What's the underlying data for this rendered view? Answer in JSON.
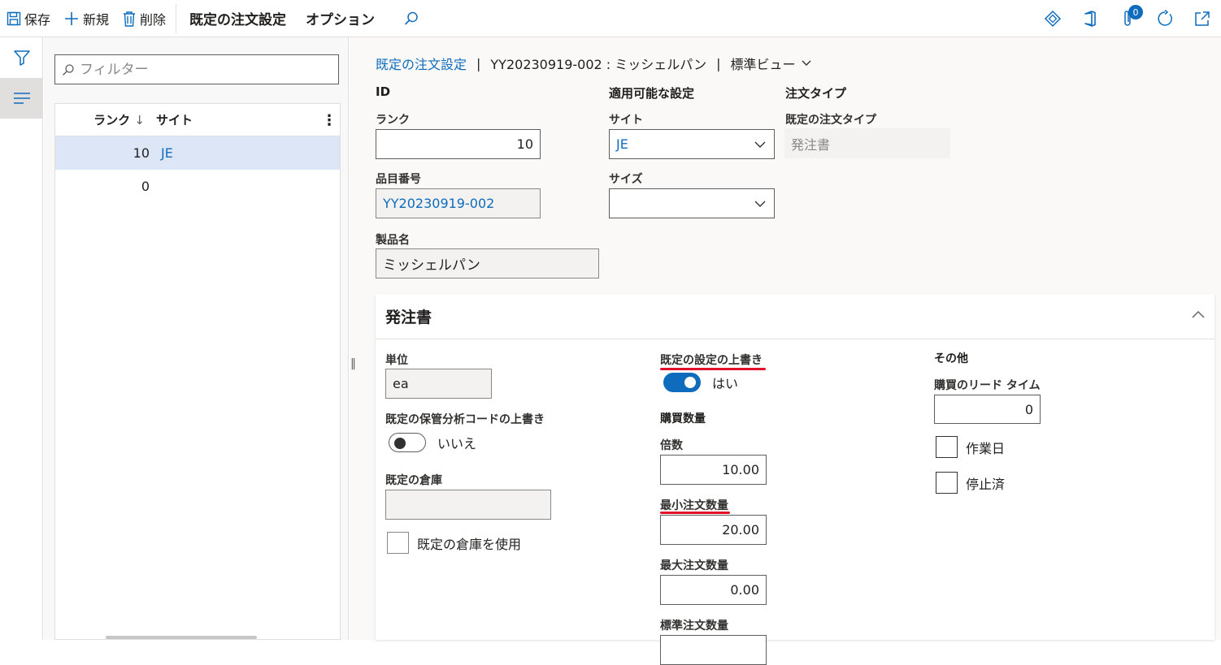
{
  "toolbar": {
    "save": "保存",
    "new": "新規",
    "delete": "削除",
    "tab_default_order": "既定の注文設定",
    "tab_options": "オプション",
    "notification_count": "0"
  },
  "list": {
    "filter_placeholder": "フィルター",
    "col_rank": "ランク",
    "col_site": "サイト",
    "rows": [
      {
        "rank": "10",
        "site": "JE"
      },
      {
        "rank": "0",
        "site": ""
      }
    ]
  },
  "breadcrumb": {
    "link": "既定の注文設定",
    "record": "YY20230919-002 : ミッシェルパン",
    "view": "標準ビュー"
  },
  "header": {
    "id_group": "ID",
    "rank_label": "ランク",
    "rank_value": "10",
    "item_label": "品目番号",
    "item_value": "YY20230919-002",
    "product_label": "製品名",
    "product_value": "ミッシェルパン",
    "applicable_group": "適用可能な設定",
    "site_label": "サイト",
    "site_value": "JE",
    "size_label": "サイズ",
    "size_value": "",
    "order_type_group": "注文タイプ",
    "default_order_type_label": "既定の注文タイプ",
    "default_order_type_value": "発注書"
  },
  "purchase": {
    "title": "発注書",
    "unit_label": "単位",
    "unit_value": "ea",
    "override_dim_label": "既定の保管分析コードの上書き",
    "override_dim_value": "いいえ",
    "warehouse_label": "既定の倉庫",
    "warehouse_value": "",
    "use_warehouse_label": "既定の倉庫を使用",
    "override_label": "既定の設定の上書き",
    "override_value": "はい",
    "qty_group": "購買数量",
    "multiple_label": "倍数",
    "multiple_value": "10.00",
    "min_label": "最小注文数量",
    "min_value": "20.00",
    "max_label": "最大注文数量",
    "max_value": "0.00",
    "std_label": "標準注文数量",
    "other_group": "その他",
    "lead_time_label": "購買のリード タイム",
    "lead_time_value": "0",
    "workdays_label": "作業日",
    "stopped_label": "停止済"
  },
  "colors": {
    "accent": "#0f6cbd",
    "selected_row": "#dce6f7",
    "annotation": "#e3102a"
  }
}
